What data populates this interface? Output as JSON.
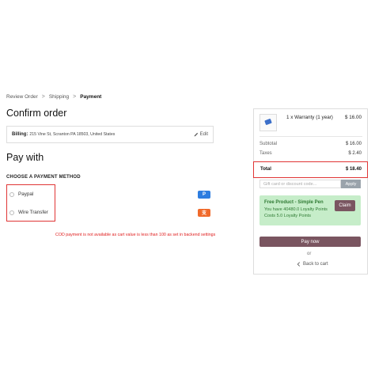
{
  "breadcrumb": {
    "items": [
      "Review Order",
      "Shipping",
      "Payment"
    ],
    "separator": ">"
  },
  "main": {
    "title": "Confirm order",
    "billing": {
      "label": "Billing:",
      "address": "215 Vine St, Scranton PA 18503, United States",
      "edit_label": "Edit"
    },
    "pay_with_title": "Pay with",
    "choose_method_label": "CHOOSE A PAYMENT METHOD",
    "payment_methods": [
      {
        "label": "Paypal",
        "logo_icon": "paypal-logo-icon",
        "logo_glyph": "P",
        "logo_color": "#2d7de0"
      },
      {
        "label": "Wire Transfer",
        "logo_icon": "alipay-logo-icon",
        "logo_glyph": "支",
        "logo_color": "#f06a2b"
      }
    ],
    "cod_message": "COD payment is not available as cart value is less than 100 as set in backend settings"
  },
  "summary": {
    "product": {
      "name": "1 x Warranty (1 year)",
      "price": "$ 16.00"
    },
    "subtotal_label": "Subtotal",
    "subtotal_value": "$ 16.00",
    "taxes_label": "Taxes",
    "taxes_value": "$ 2.40",
    "total_label": "Total",
    "total_value": "$ 18.40",
    "coupon_placeholder": "Gift card or discount code...",
    "apply_label": "Apply",
    "promo": {
      "title": "Free Product - Simple Pen",
      "line1": "You have 40480.0 Loyalty Points",
      "line2": "Costs 5.0 Loyalty Points",
      "claim_label": "Claim"
    },
    "pay_now_label": "Pay now",
    "or_label": "or",
    "back_label": "Back to cart"
  },
  "colors": {
    "highlight": "#e03535",
    "accent_button": "#7a5560",
    "promo_bg": "#c6edc9",
    "promo_text": "#2f7a33",
    "error_text": "#e02020"
  }
}
